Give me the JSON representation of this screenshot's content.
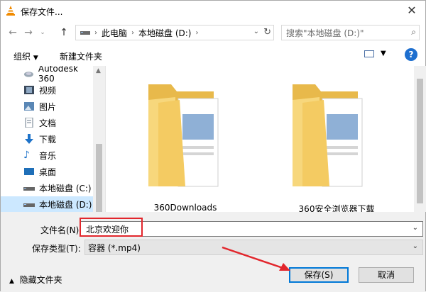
{
  "window": {
    "title": "保存文件..."
  },
  "nav": {
    "breadcrumb": [
      "此电脑",
      "本地磁盘 (D:)"
    ],
    "search_placeholder": "搜索\"本地磁盘 (D:)\""
  },
  "toolbar": {
    "organize": "组织",
    "new_folder": "新建文件夹",
    "help": "?"
  },
  "sidebar": {
    "items": [
      {
        "label": "Autodesk 360",
        "icon": "cloud-icon"
      },
      {
        "label": "视频",
        "icon": "video-icon"
      },
      {
        "label": "图片",
        "icon": "picture-icon"
      },
      {
        "label": "文档",
        "icon": "document-icon"
      },
      {
        "label": "下载",
        "icon": "download-icon"
      },
      {
        "label": "音乐",
        "icon": "music-icon"
      },
      {
        "label": "桌面",
        "icon": "desktop-icon"
      },
      {
        "label": "本地磁盘 (C:)",
        "icon": "drive-icon"
      },
      {
        "label": "本地磁盘 (D:)",
        "icon": "drive-icon",
        "selected": true
      }
    ]
  },
  "files": [
    {
      "name": "360Downloads",
      "icon": "folder-icon"
    },
    {
      "name": "360安全浏览器下载",
      "icon": "folder-icon"
    }
  ],
  "form": {
    "filename_label": "文件名(N):",
    "filename_value": "北京欢迎你",
    "type_label": "保存类型(T):",
    "type_value": "容器 (*.mp4)",
    "hide_folders": "隐藏文件夹",
    "save": "保存(S)",
    "cancel": "取消"
  },
  "colors": {
    "accent": "#0078d7",
    "highlight": "#e2262c",
    "selected_bg": "#cce8ff",
    "folder": "#f7d77c"
  }
}
